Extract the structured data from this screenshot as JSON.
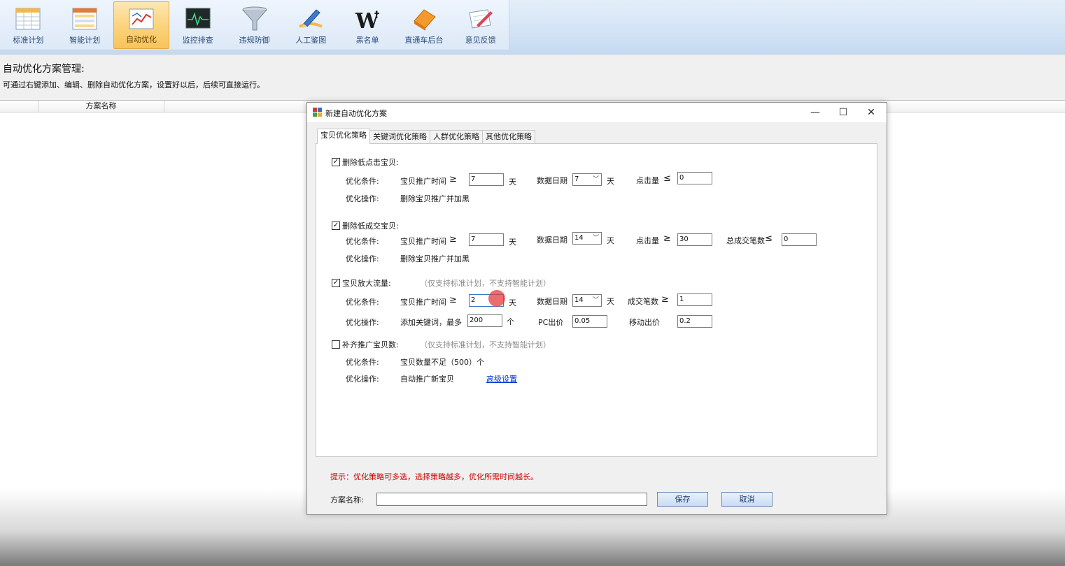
{
  "toolbar": {
    "items": [
      {
        "label": "标准计划",
        "icon": "spreadsheet-icon",
        "active": false
      },
      {
        "label": "智能计划",
        "icon": "smart-plan-icon",
        "active": false
      },
      {
        "label": "自动优化",
        "icon": "chart-icon",
        "active": true
      },
      {
        "label": "监控排查",
        "icon": "monitor-icon",
        "active": false
      },
      {
        "label": "违规防御",
        "icon": "funnel-icon",
        "active": false
      },
      {
        "label": "人工鉴图",
        "icon": "pen-icon",
        "active": false
      },
      {
        "label": "黑名单",
        "icon": "blacklist-icon",
        "active": false
      },
      {
        "label": "直通车后台",
        "icon": "eraser-icon",
        "active": false
      },
      {
        "label": "意见反馈",
        "icon": "feedback-icon",
        "active": false
      }
    ]
  },
  "page": {
    "title": "自动优化方案管理:",
    "description": "可通过右键添加、编辑、删除自动优化方案，设置好以后，后续可直接运行。"
  },
  "list": {
    "columns": [
      "",
      "方案名称"
    ]
  },
  "dialog": {
    "title": "新建自动优化方案",
    "tabs": [
      "宝贝优化策略",
      "关键词优化策略",
      "人群优化策略",
      "其他优化策略"
    ],
    "sections": {
      "low_click": {
        "checked": "✓",
        "title": "删除低点击宝贝:",
        "cond_label": "优化条件:",
        "promo_time_label": "宝贝推广时间",
        "ge": "≥",
        "promo_time_value": "7",
        "day": "天",
        "date_label": "数据日期",
        "date_value": "7",
        "clicks_label": "点击量",
        "le": "≤",
        "clicks_value": "0",
        "op_label": "优化操作:",
        "op_value": "删除宝贝推广并加黑"
      },
      "low_deal": {
        "checked": "✓",
        "title": "删除低成交宝贝:",
        "cond_label": "优化条件:",
        "promo_time_label": "宝贝推广时间",
        "ge": "≥",
        "promo_time_value": "7",
        "day": "天",
        "date_label": "数据日期",
        "date_value": "14",
        "clicks_label": "点击量",
        "clicks_value": "30",
        "deals_label": "总成交笔数",
        "le": "≤",
        "deals_value": "0",
        "op_label": "优化操作:",
        "op_value": "删除宝贝推广并加黑"
      },
      "amplify": {
        "checked": "✓",
        "title": "宝贝放大流量:",
        "hint": "（仅支持标准计划，不支持智能计划）",
        "cond_label": "优化条件:",
        "promo_time_label": "宝贝推广时间",
        "ge": "≥",
        "promo_time_value": "2",
        "day": "天",
        "date_label": "数据日期",
        "date_value": "14",
        "deals_label": "成交笔数",
        "deals_value": "1",
        "op_label": "优化操作:",
        "add_kw_label": "添加关键词，最多",
        "add_kw_value": "200",
        "unit": "个",
        "pc_label": "PC出价",
        "pc_value": "0.05",
        "mobile_label": "移动出价",
        "mobile_value": "0.2"
      },
      "fill": {
        "checked": "",
        "title": "补齐推广宝贝数:",
        "hint": "（仅支持标准计划，不支持智能计划）",
        "cond_label": "优化条件:",
        "cond_value": "宝贝数量不足（500）个",
        "op_label": "优化操作:",
        "op_value": "自动推广新宝贝",
        "advanced_link": "高级设置"
      }
    },
    "tip": "提示：优化策略可多选，选择策略越多，优化所需时间越长。",
    "name_label": "方案名称:",
    "name_value": "",
    "save_label": "保存",
    "cancel_label": "取消"
  }
}
